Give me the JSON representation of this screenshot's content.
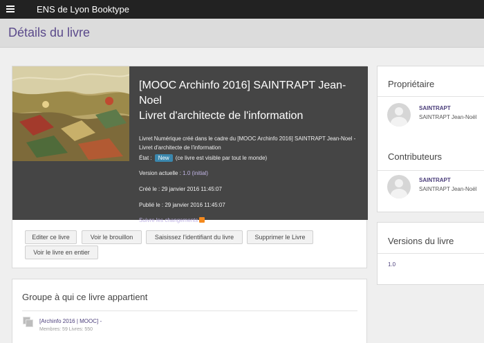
{
  "app": {
    "title": "ENS de Lyon Booktype"
  },
  "page": {
    "title": "Détails du livre"
  },
  "book": {
    "title_line1": "[MOOC Archinfo 2016] SAINTRAPT Jean-Noel",
    "title_line2": "Livret d'architecte de l'information",
    "description": "Livret Numérique créé dans le cadre du [MOOC Archinfo 2016] SAINTRAPT Jean-Noel - Livret d'architecte de l'information",
    "state_label": "État :",
    "state_badge": "New",
    "state_note": "(ce livre est visible par tout le monde)",
    "version_label": "Version actuelle :",
    "version_value": "1.0 (initial)",
    "created": "Créé le : 29 janvier 2016 11:45:07",
    "published": "Publié le : 29 janvier 2016 11:45:07",
    "follow_changes": "Suivre les changements"
  },
  "actions": {
    "edit": "Editer ce livre",
    "draft": "Voir le brouillon",
    "identifier": "Saisissez l'identifiant du livre",
    "delete": "Supprimer le Livre",
    "view_full": "Voir le livre en entier"
  },
  "group": {
    "heading": "Groupe à qui ce livre appartient",
    "name": "[Archinfo 2016 | MOOC] -",
    "stats": "Membres: 59 Livres: 550"
  },
  "owner": {
    "heading": "Propriétaire",
    "username": "SAINTRAPT",
    "fullname": "SAINTRAPT Jean-Noël"
  },
  "contributors": {
    "heading": "Contributeurs",
    "username": "SAINTRAPT",
    "fullname": "SAINTRAPT Jean-Noël"
  },
  "versions": {
    "heading": "Versions du livre",
    "items": [
      "1.0"
    ]
  }
}
